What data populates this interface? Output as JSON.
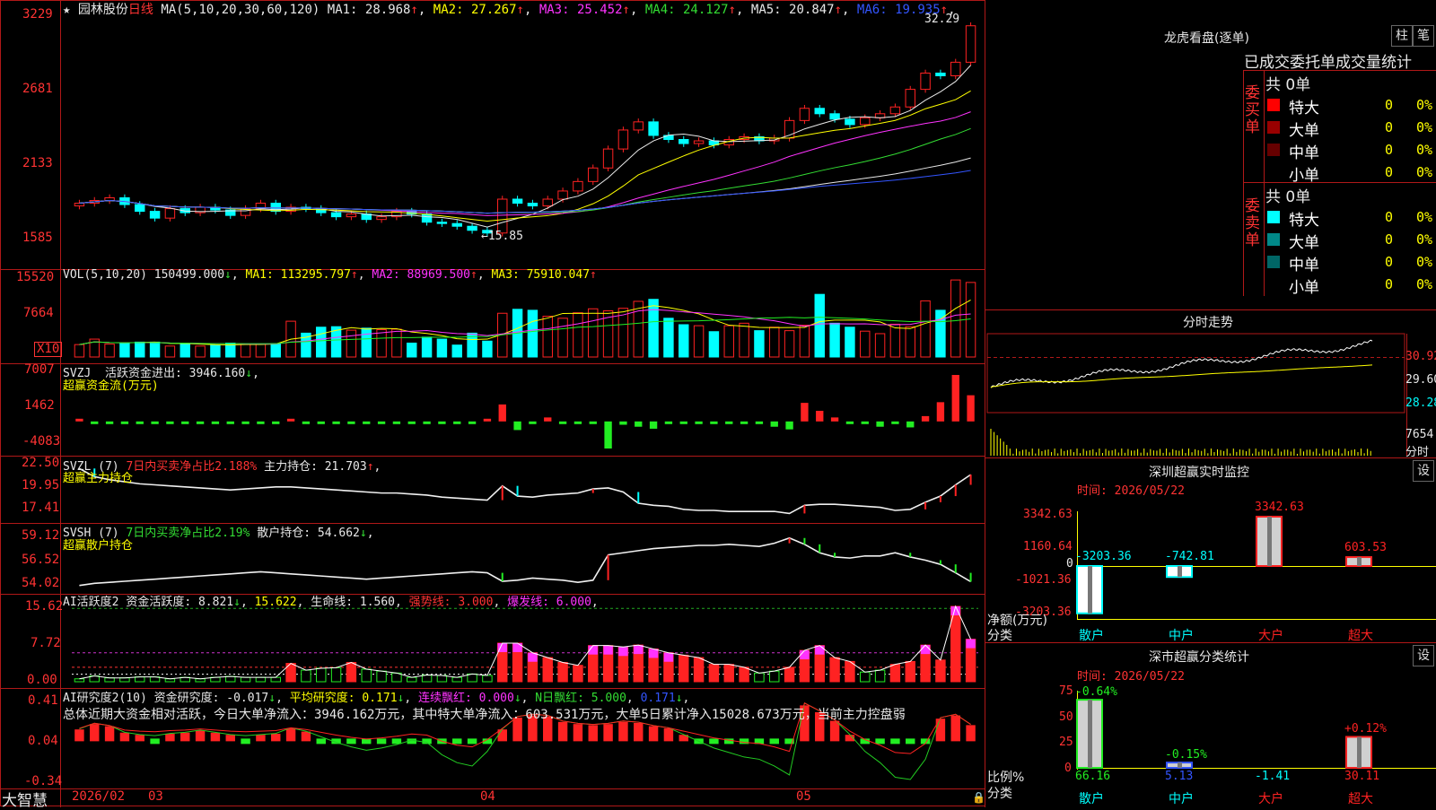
{
  "app": {
    "logo": "大智慧",
    "lock_icon": "lock-icon"
  },
  "header": {
    "star": "★",
    "stock_name": "园林股份",
    "period": "日线",
    "ma_spec": "MA(5,10,20,30,60,120)",
    "ma1": "MA1: 28.968",
    "ma2": "MA2: 27.267",
    "ma3": "MA3: 25.452",
    "ma4": "MA4: 24.127",
    "ma5": "MA5: 20.847",
    "ma6": "MA6: 19.935",
    "arrow_up": "↑",
    "sep": ",",
    "hi_label": "32.29",
    "lo_label": "←15.85"
  },
  "price_axis": [
    "3229",
    "2681",
    "2133",
    "1585"
  ],
  "vol": {
    "title": "VOL(5,10,20)",
    "val": "150499.000",
    "ma1": "MA1: 113295.797",
    "ma2": "MA2: 88969.500",
    "ma3": "MA3: 75910.047",
    "axis": [
      "15520",
      "7664"
    ],
    "unit": "X10",
    "down": "↓",
    "up": "↑"
  },
  "svzj": {
    "title": "SVZJ",
    "label": "活跃资金进出: 3946.160",
    "arrow": "↓",
    "sub": "超赢资金流(万元)",
    "axis": [
      "7007",
      "1462",
      "-4083"
    ]
  },
  "svzl": {
    "title": "SVZL (7)",
    "label1": "7日内买卖净占比2.188%",
    "label2": "主力持仓: 21.703",
    "arrow": "↑",
    "sub": "超赢主力持仓",
    "axis": [
      "22.50",
      "19.95",
      "17.41"
    ]
  },
  "svsh": {
    "title": "SVSH (7)",
    "label1": "7日内买卖净占比2.19%",
    "label2": "散户持仓: 54.662",
    "arrow": "↓",
    "sub": "超赢散户持仓",
    "axis": [
      "59.12",
      "56.52",
      "54.02"
    ]
  },
  "aihy": {
    "title": "AI活跃度2",
    "label1": "资金活跃度: 8.821",
    "a1": "↓",
    "label2": "15.622",
    "label3": "生命线: 1.560",
    "label4": "强势线: 3.000",
    "label5": "爆发线: 6.000",
    "axis": [
      "15.62",
      "7.72",
      "0.00"
    ]
  },
  "aiyj": {
    "title": "AI研究度2(10)",
    "label1": "资金研究度: -0.017",
    "label2": "平均研究度: 0.171",
    "label3": "连续飘红: 0.000",
    "label4": "N日飘红: 5.000",
    "label5": "0.171",
    "down": "↓",
    "summary": "总体近期大资金相对活跃，今日大单净流入：3946.162万元，其中特大单净流入：603.531万元，大单5日累计净入15028.673万元，当前主力控盘弱",
    "axis": [
      "0.41",
      "0.04",
      "-0.34"
    ]
  },
  "time_axis": [
    "2026/02",
    "03",
    "04",
    "05"
  ],
  "lhb": {
    "title": "龙虎看盘(逐单)",
    "btn1": "柱",
    "btn2": "笔",
    "subtitle": "已成交委托单成交量统计",
    "buy_label": "委买单",
    "sell_label": "委卖单",
    "buy_total": "共 0单",
    "sell_total": "共 0单",
    "buy_rows": [
      {
        "name": "特大",
        "count": "0",
        "pct": "0%",
        "color": "#ff0000"
      },
      {
        "name": "大单",
        "count": "0",
        "pct": "0%",
        "color": "#990000"
      },
      {
        "name": "中单",
        "count": "0",
        "pct": "0%",
        "color": "#660000"
      },
      {
        "name": "小单",
        "count": "0",
        "pct": "0%",
        "color": "#000000"
      }
    ],
    "sell_rows": [
      {
        "name": "特大",
        "count": "0",
        "pct": "0%",
        "color": "#00ffff"
      },
      {
        "name": "大单",
        "count": "0",
        "pct": "0%",
        "color": "#008888"
      },
      {
        "name": "中单",
        "count": "0",
        "pct": "0%",
        "color": "#006666"
      },
      {
        "name": "小单",
        "count": "0",
        "pct": "0%",
        "color": "#000000"
      }
    ]
  },
  "intraday": {
    "title": "分时走势",
    "axis": [
      "30.92",
      "29.60",
      "28.28"
    ],
    "vol_axis": "7654",
    "vol_label": "分时"
  },
  "sz_monitor": {
    "title": "深圳超赢实时监控",
    "btn": "设",
    "time": "时间: 2026/05/22",
    "axis": [
      "3342.63",
      "1160.64",
      "0",
      "-1021.36",
      "-3203.36"
    ],
    "ylabel": "净额(万元)",
    "xlabel": "分类",
    "bars": [
      {
        "cat": "散户",
        "value": -3203.36,
        "label": "-3203.36"
      },
      {
        "cat": "中户",
        "value": -742.81,
        "label": "-742.81"
      },
      {
        "cat": "大户",
        "value": 3342.63,
        "label": "3342.63"
      },
      {
        "cat": "超大",
        "value": 603.53,
        "label": "603.53"
      }
    ]
  },
  "sz_class": {
    "title": "深市超赢分类统计",
    "btn": "设",
    "time": "时间: 2026/05/22",
    "axis": [
      "75",
      "50",
      "25",
      "0"
    ],
    "ylabel": "比例%",
    "xlabel": "分类",
    "bars": [
      {
        "cat": "散户",
        "value": 66.16,
        "label": "66.16",
        "change": "-0.64%"
      },
      {
        "cat": "中户",
        "value": 5.13,
        "label": "5.13",
        "change": "-0.15%"
      },
      {
        "cat": "大户",
        "value": -1.41,
        "label": "-1.41",
        "change": ""
      },
      {
        "cat": "超大",
        "value": 30.11,
        "label": "30.11",
        "change": "+0.12%"
      }
    ]
  },
  "chart_data": [
    {
      "type": "candlestick",
      "title": "园林股份 日线",
      "ylim": [
        15.85,
        32.29
      ],
      "x": [
        "2026/02",
        "03",
        "04",
        "05"
      ],
      "close": [
        19.2,
        19.4,
        19.6,
        19.1,
        18.6,
        18.1,
        18.8,
        18.5,
        18.9,
        18.7,
        18.3,
        18.8,
        19.2,
        18.6,
        18.9,
        18.8,
        18.5,
        18.2,
        18.4,
        18.0,
        18.2,
        18.6,
        18.4,
        17.8,
        17.7,
        17.5,
        17.2,
        17.0,
        19.5,
        19.2,
        19.0,
        19.5,
        20.1,
        20.8,
        21.8,
        23.2,
        24.6,
        25.2,
        24.2,
        23.9,
        23.6,
        23.8,
        23.5,
        23.9,
        24.1,
        23.8,
        24.0,
        25.3,
        26.2,
        25.8,
        25.4,
        25.0,
        25.5,
        25.8,
        26.3,
        27.6,
        28.8,
        28.6,
        29.6,
        32.29
      ],
      "ma": [
        {
          "name": "MA1",
          "color": "#e8e8e8",
          "value": 28.968
        },
        {
          "name": "MA2",
          "color": "#ffff00",
          "value": 27.267
        },
        {
          "name": "MA3",
          "color": "#ff33ff",
          "value": 25.452
        },
        {
          "name": "MA4",
          "color": "#33dd33",
          "value": 24.127
        },
        {
          "name": "MA5",
          "color": "#e8e8e8",
          "value": 20.847
        },
        {
          "name": "MA6",
          "color": "#3355ff",
          "value": 19.935
        }
      ]
    },
    {
      "type": "bar",
      "title": "VOL(5,10,20)",
      "unit": "X10",
      "ylim": [
        0,
        15520
      ],
      "values": [
        2500,
        3600,
        2600,
        2800,
        3000,
        3000,
        2200,
        2600,
        2200,
        2400,
        2800,
        2600,
        2600,
        2700,
        7200,
        4800,
        6000,
        6100,
        5400,
        5800,
        5500,
        5600,
        2800,
        4000,
        3600,
        2400,
        4800,
        3200,
        8800,
        9600,
        9400,
        8200,
        7800,
        8900,
        9700,
        9300,
        9800,
        11200,
        11600,
        7800,
        6500,
        6300,
        5100,
        6300,
        6800,
        5300,
        6000,
        5300,
        6400,
        12600,
        6800,
        6000,
        5200,
        4700,
        6600,
        6100,
        11300,
        9400,
        15500,
        15000
      ]
    },
    {
      "type": "bar",
      "title": "SVZJ 活跃资金进出",
      "ylim": [
        -4083,
        7007
      ],
      "values": [
        10,
        -80,
        -80,
        -60,
        -100,
        -60,
        -80,
        -40,
        -40,
        -60,
        -40,
        -60,
        -40,
        -40,
        380,
        -60,
        -100,
        -60,
        -40,
        -60,
        -60,
        -40,
        -20,
        -40,
        -20,
        -40,
        -40,
        120,
        2560,
        -1300,
        -200,
        600,
        -300,
        -200,
        -300,
        -4083,
        -500,
        -800,
        -1100,
        -100,
        -200,
        -100,
        -100,
        -400,
        -200,
        -100,
        -800,
        -1200,
        2800,
        1600,
        600,
        -200,
        -300,
        -800,
        -300,
        -900,
        800,
        2900,
        7007,
        3946
      ]
    },
    {
      "type": "line",
      "title": "SVZL 主力持仓",
      "ylim": [
        17.41,
        22.5
      ],
      "values": [
        22.3,
        21.5,
        21.2,
        21.0,
        20.8,
        20.7,
        20.6,
        20.5,
        20.4,
        20.3,
        20.2,
        20.3,
        20.4,
        20.5,
        20.5,
        20.4,
        20.3,
        20.2,
        20.1,
        20.0,
        19.9,
        19.9,
        19.8,
        19.7,
        19.5,
        19.4,
        19.3,
        19.2,
        20.6,
        19.6,
        19.5,
        19.7,
        19.8,
        19.9,
        20.3,
        20.4,
        20.0,
        18.9,
        18.7,
        18.6,
        18.3,
        18.2,
        18.2,
        18.1,
        18.1,
        18.1,
        18.1,
        17.9,
        18.7,
        18.8,
        18.8,
        18.7,
        18.6,
        18.5,
        18.2,
        18.3,
        19.0,
        19.6,
        20.7,
        21.7
      ]
    },
    {
      "type": "line",
      "title": "SVSH 散户持仓",
      "ylim": [
        54.02,
        59.12
      ],
      "values": [
        54.3,
        54.5,
        54.6,
        54.7,
        54.8,
        54.9,
        55.0,
        55.1,
        55.2,
        55.3,
        55.4,
        55.5,
        55.6,
        55.5,
        55.4,
        55.3,
        55.2,
        55.1,
        55.0,
        54.9,
        55.0,
        55.1,
        55.2,
        55.3,
        55.4,
        55.5,
        55.6,
        55.5,
        54.7,
        54.8,
        55.0,
        54.9,
        54.8,
        54.6,
        54.8,
        57.2,
        57.4,
        57.6,
        57.8,
        57.9,
        58.0,
        58.1,
        58.1,
        58.2,
        58.1,
        58.0,
        58.3,
        58.8,
        58.2,
        57.4,
        57.0,
        56.9,
        57.1,
        57.1,
        57.4,
        57.0,
        56.7,
        56.3,
        55.5,
        54.66
      ]
    },
    {
      "type": "bar",
      "title": "AI活跃度2",
      "ylim": [
        0,
        15.62
      ],
      "values": [
        0.6,
        1.2,
        0.8,
        0.8,
        1.0,
        1.0,
        0.6,
        0.9,
        0.6,
        0.9,
        1.1,
        0.9,
        0.9,
        0.9,
        3.8,
        2.4,
        2.8,
        2.9,
        4.0,
        2.6,
        2.2,
        1.8,
        0.9,
        1.4,
        1.3,
        0.9,
        1.6,
        1.3,
        8.0,
        8.0,
        6.0,
        5.0,
        4.0,
        3.4,
        7.5,
        7.5,
        7.2,
        7.6,
        6.8,
        6.0,
        5.5,
        5.0,
        3.6,
        3.6,
        3.0,
        1.8,
        2.2,
        3.0,
        6.5,
        7.5,
        5.0,
        4.2,
        2.0,
        2.4,
        3.6,
        4.2,
        7.6,
        4.5,
        15.62,
        8.82
      ]
    },
    {
      "type": "line",
      "title": "AI研究度2(10)",
      "ylim": [
        -0.34,
        0.41
      ],
      "values": [
        0.15,
        0.2,
        0.18,
        0.12,
        0.1,
        0.09,
        0.11,
        0.12,
        0.14,
        0.12,
        0.1,
        0.09,
        0.1,
        0.11,
        0.16,
        0.13,
        0.08,
        0.03,
        -0.01,
        -0.04,
        -0.02,
        0.01,
        0.05,
        0.03,
        -0.08,
        -0.15,
        -0.18,
        -0.05,
        0.15,
        0.26,
        0.28,
        0.27,
        0.22,
        0.2,
        0.19,
        0.2,
        0.22,
        0.21,
        0.18,
        0.16,
        0.1,
        0.04,
        -0.02,
        -0.06,
        -0.1,
        -0.12,
        -0.18,
        -0.26,
        0.38,
        0.31,
        0.23,
        0.1,
        -0.05,
        -0.15,
        -0.28,
        -0.3,
        -0.12,
        0.25,
        0.28,
        0.19
      ]
    }
  ]
}
